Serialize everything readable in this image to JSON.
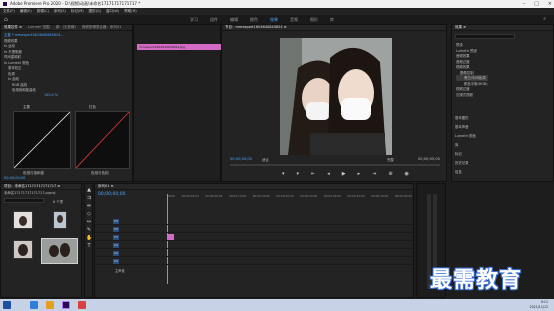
{
  "titlebar": {
    "title": "Adobe Premiere Pro 2020 - D:\\视频\\动画\\未命名17171717171717 *"
  },
  "menu": [
    "文件(F)",
    "编辑(E)",
    "剪辑(C)",
    "序列(S)",
    "标记(M)",
    "图形(G)",
    "窗口(W)",
    "帮助(H)"
  ],
  "workspaces": [
    "学习",
    "组件",
    "编辑",
    "颜色",
    "效果",
    "音频",
    "图形",
    "库"
  ],
  "active_workspace_index": 4,
  "effect_controls": {
    "tabs": [
      "效果控件 ≡",
      "Lumetri 范围",
      "源：(无剪辑)",
      "音频剪辑混合器：序列01"
    ],
    "source": "主要 * mmexport1604640840624...",
    "clip_label": "序列01 * mmexport1604...",
    "rows": [
      "fx 运动",
      "fx 不透明度",
      "时间重映射",
      "fx Lumetri 颜色",
      "基本校正",
      "色调",
      "fx 曲线",
      "RGB 曲线",
      "色相饱和度曲线"
    ],
    "value_label": "100.0 %",
    "curve_labels": [
      "主要",
      "红色"
    ],
    "sub_labels": [
      "色相与饱和度",
      "色相与色相"
    ],
    "timecode": "00;00;00;00"
  },
  "clip_bar": {
    "label": "mmexport1604640840624.jpg",
    "color": "#d36bc4"
  },
  "program": {
    "title": "节目：mmexport1604640840624 ≡",
    "timecode": "00;00;00;00",
    "fit": "适合",
    "quality": "完整",
    "duration": "00;00;05;00"
  },
  "project": {
    "title": "项目：未命名17171717171717 ≡",
    "path": "未命名17171717171717.prproj",
    "item_count": "6 个项"
  },
  "timeline": {
    "tab": "序列01 ≡",
    "timecode": "00;00;00;00",
    "ruler": [
      "00;00",
      "00;00;04;00",
      "00;00;08;00",
      "00;00;12;00",
      "00;00;16;00",
      "00;00;20;00",
      "00;00;24;00",
      "00;00;28;00",
      "00;00;32;00",
      "00;00;36;00",
      "00;00;40;00"
    ],
    "tracks": [
      "V3",
      "V2",
      "V1",
      "A1",
      "A2",
      "A3"
    ],
    "master": "主声道"
  },
  "right_panel": {
    "title": "效果 ≡",
    "tree": [
      "预设",
      "Lumetri 预设",
      "音频效果",
      "音频过渡",
      "视频效果",
      "图像控制",
      "黑白/中间色调",
      "颜色平衡(RGB)",
      "视频过渡",
      "沉浸式视频"
    ],
    "list": [
      "基本图形",
      "基本声音",
      "Lumetri 颜色",
      "库",
      "标记",
      "历史记录",
      "信息"
    ]
  },
  "watermark": "最需教育",
  "taskbar": {
    "time": "9:11",
    "date": "2021/11/12"
  }
}
